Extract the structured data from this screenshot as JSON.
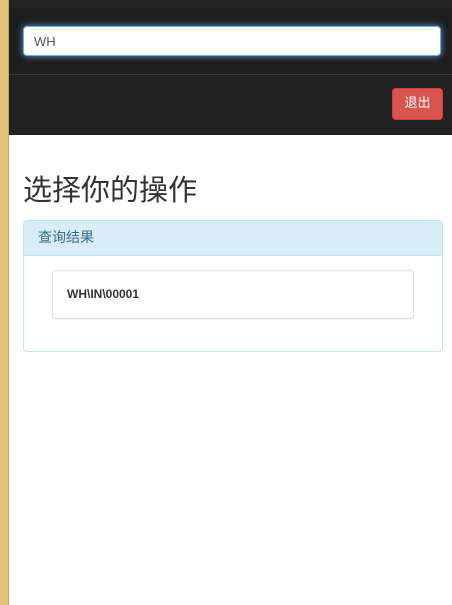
{
  "search": {
    "value": "WH"
  },
  "navbar": {
    "logout_label": "退出"
  },
  "main": {
    "title": "选择你的操作",
    "results_panel": {
      "heading": "查询结果",
      "items": [
        {
          "label": "WH\\IN\\00001"
        }
      ]
    }
  },
  "colors": {
    "navbar_bg": "#222222",
    "danger": "#d9534f",
    "info_heading_bg": "#d9edf7",
    "info_heading_text": "#31708f",
    "info_border": "#bce8f1",
    "focus_glow": "#66afe9",
    "left_accent": "#e3c27a"
  }
}
